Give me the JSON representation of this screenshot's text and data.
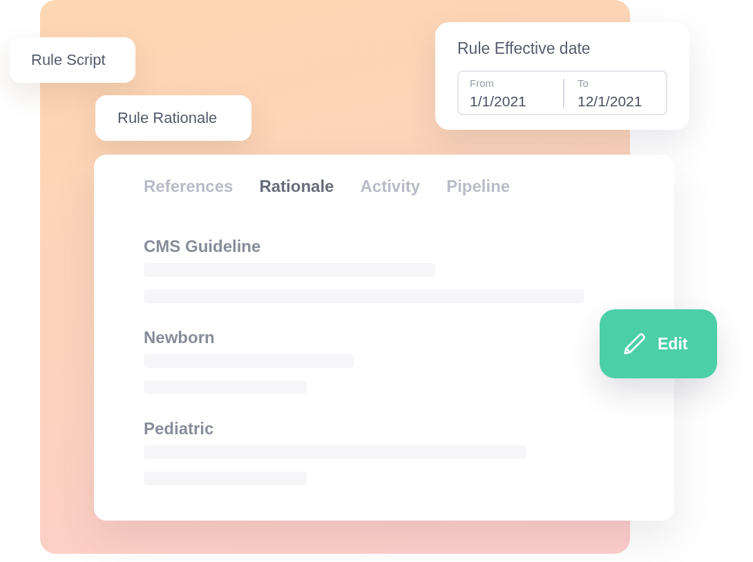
{
  "floating_labels": [
    {
      "label": "Rule Script"
    },
    {
      "label": "Rule Rationale"
    }
  ],
  "effective_date": {
    "title": "Rule Effective date",
    "from": {
      "label": "From",
      "value": "1/1/2021"
    },
    "to": {
      "label": "To",
      "value": "12/1/2021"
    }
  },
  "tabs": [
    {
      "label": "References",
      "selected": false
    },
    {
      "label": "Rationale",
      "selected": true
    },
    {
      "label": "Activity",
      "selected": false
    },
    {
      "label": "Pipeline",
      "selected": false
    }
  ],
  "sections": [
    {
      "heading": "CMS Guideline"
    },
    {
      "heading": "Newborn"
    },
    {
      "heading": "Pediatric"
    }
  ],
  "edit_button": {
    "label": "Edit"
  }
}
